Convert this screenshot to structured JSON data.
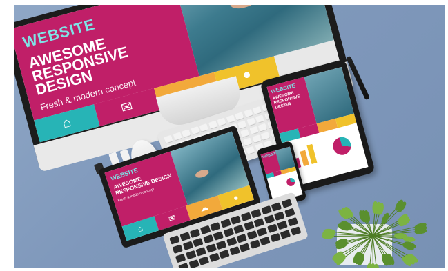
{
  "desktop": {
    "brand": "WEBSITE",
    "headline": "AWESOME RESPONSIVE DESIGN",
    "tagline": "Fresh & modern concept",
    "body_text": ""
  },
  "tablet": {
    "brand": "WEBSITE",
    "headline": "AWESOME RESPONSIVE DESIGN"
  },
  "laptop": {
    "brand": "WEBSITE",
    "headline": "AWESOME RESPONSIVE DESIGN",
    "tagline": "Fresh & modern concept"
  },
  "phone": {
    "brand": "WEBSITE"
  },
  "colors": {
    "background": "#8aa2c2",
    "magenta": "#c01f68",
    "teal": "#27b4b6",
    "orange": "#f2a93b",
    "yellow": "#f0c22b"
  },
  "icons": [
    "home-icon",
    "mail-icon",
    "cloud-icon",
    "user-icon"
  ]
}
